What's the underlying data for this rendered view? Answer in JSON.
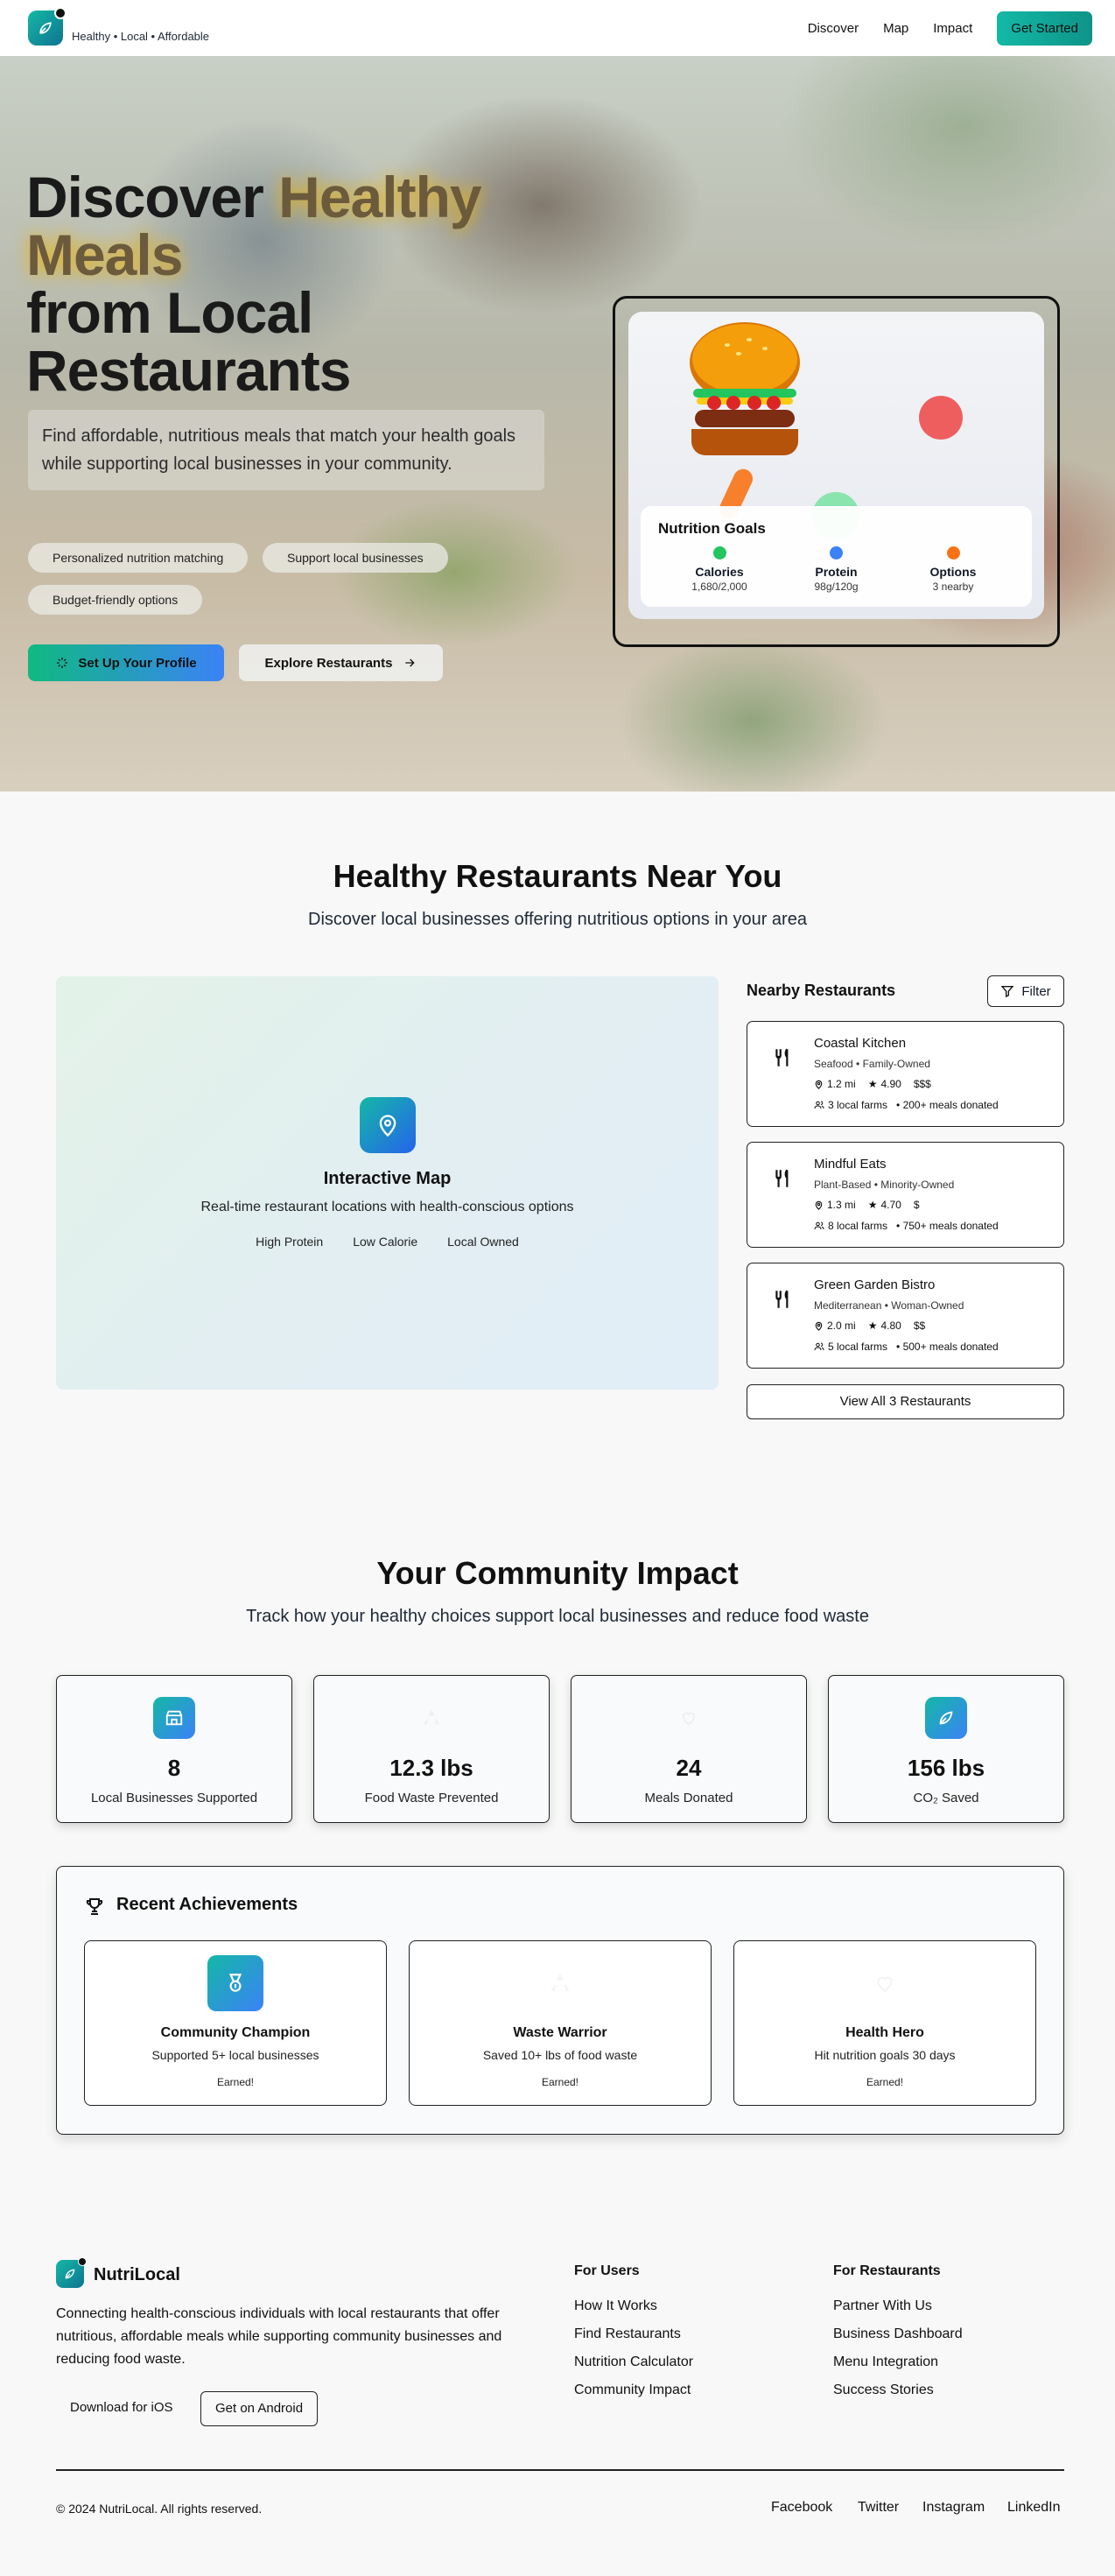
{
  "header": {
    "tagline": "Healthy • Local • Affordable",
    "nav": [
      "Discover",
      "Map",
      "Impact"
    ],
    "cta": "Get Started",
    "logo_icon": "leaf-icon"
  },
  "hero": {
    "title_line1_a": "Discover ",
    "title_line1_b": "Healthy",
    "title_line2": "Meals",
    "title_line3": "from Local",
    "title_line4": "Restaurants",
    "subtitle": "Find affordable, nutritious meals that match your health goals while supporting local businesses in your community.",
    "chips": [
      "Personalized nutrition matching",
      "Support local businesses",
      "Budget-friendly options"
    ],
    "primary_button": "Set Up Your Profile",
    "secondary_button": "Explore Restaurants",
    "nutrition_card": {
      "title": "Nutrition Goals",
      "items": [
        {
          "label": "Calories",
          "value": "1,680/2,000",
          "color": "#22c55e"
        },
        {
          "label": "Protein",
          "value": "98g/120g",
          "color": "#3b82f6"
        },
        {
          "label": "Options",
          "value": "3 nearby",
          "color": "#f97316"
        }
      ]
    }
  },
  "restaurants_section": {
    "title": "Healthy Restaurants Near You",
    "subtitle": "Discover local businesses offering nutritious options in your area",
    "map": {
      "title": "Interactive Map",
      "subtitle": "Real-time restaurant locations with health-conscious options",
      "tags": [
        "High Protein",
        "Low Calorie",
        "Local Owned"
      ]
    },
    "nearby_title": "Nearby Restaurants",
    "filter_label": "Filter",
    "restaurants": [
      {
        "name": "Coastal Kitchen",
        "meta": "Seafood • Family-Owned",
        "distance": "1.2 mi",
        "rating": "4.90",
        "price": "$$$",
        "farms": "3 local farms",
        "donated": "• 200+ meals donated"
      },
      {
        "name": "Mindful Eats",
        "meta": "Plant-Based • Minority-Owned",
        "distance": "1.3 mi",
        "rating": "4.70",
        "price": "$",
        "farms": "8 local farms",
        "donated": "• 750+ meals donated"
      },
      {
        "name": "Green Garden Bistro",
        "meta": "Mediterranean • Woman-Owned",
        "distance": "2.0 mi",
        "rating": "4.80",
        "price": "$$",
        "farms": "5 local farms",
        "donated": "• 500+ meals donated"
      }
    ],
    "view_all": "View All 3 Restaurants"
  },
  "impact_section": {
    "title": "Your Community Impact",
    "subtitle": "Track how your healthy choices support local businesses and reduce food waste",
    "stats": [
      {
        "value": "8",
        "label": "Local Businesses Supported",
        "icon": "store-icon"
      },
      {
        "value": "12.3 lbs",
        "label": "Food Waste Prevented",
        "icon": "recycle-icon"
      },
      {
        "value": "24",
        "label": "Meals Donated",
        "icon": "heart-icon"
      },
      {
        "value": "156 lbs",
        "label": "CO₂ Saved",
        "icon": "leaf-icon"
      }
    ],
    "achievements_title": "Recent Achievements",
    "achievements": [
      {
        "name": "Community Champion",
        "desc": "Supported 5+ local businesses",
        "status": "Earned!"
      },
      {
        "name": "Waste Warrior",
        "desc": "Saved 10+ lbs of food waste",
        "status": "Earned!"
      },
      {
        "name": "Health Hero",
        "desc": "Hit nutrition goals 30 days",
        "status": "Earned!"
      }
    ]
  },
  "footer": {
    "brand": "NutriLocal",
    "description": "Connecting health-conscious individuals with local restaurants that offer nutritious, affordable meals while supporting community businesses and reducing food waste.",
    "ios_button": "Download for iOS",
    "android_button": "Get on Android",
    "col1_title": "For Users",
    "col1_links": [
      "How It Works",
      "Find Restaurants",
      "Nutrition Calculator",
      "Community Impact"
    ],
    "col2_title": "For Restaurants",
    "col2_links": [
      "Partner With Us",
      "Business Dashboard",
      "Menu Integration",
      "Success Stories"
    ],
    "copyright": "© 2024 NutriLocal. All rights reserved.",
    "social": [
      "Facebook",
      "Twitter",
      "Instagram",
      "LinkedIn"
    ]
  },
  "colors": {
    "brand_teal": "#14b8a6",
    "brand_blue": "#3b82f6"
  }
}
